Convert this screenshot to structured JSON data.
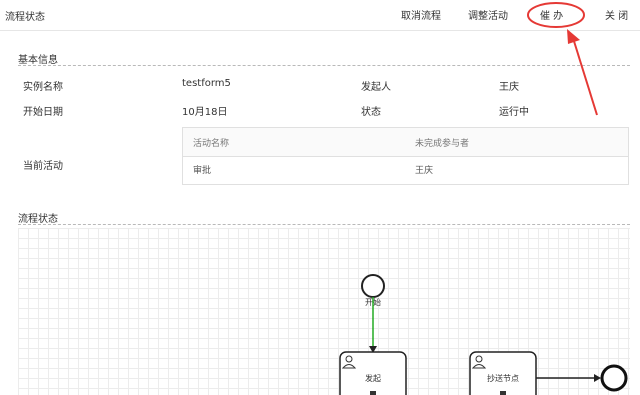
{
  "header": {
    "title": "流程状态",
    "buttons": {
      "cancel_process": "取消流程",
      "adjust_activity": "调整活动",
      "urge": "催 办",
      "close": "关 闭"
    }
  },
  "basic_info": {
    "section_title": "基本信息",
    "instance_name_label": "实例名称",
    "instance_name_value": "testform5",
    "initiator_label": "发起人",
    "initiator_value": "王庆",
    "start_date_label": "开始日期",
    "start_date_value": "10月18日",
    "status_label": "状态",
    "status_value": "运行中",
    "current_activity_label": "当前活动",
    "activity_table": {
      "columns": [
        "活动名称",
        "未完成参与者"
      ],
      "rows": [
        [
          "审批",
          "王庆"
        ]
      ]
    }
  },
  "process_status": {
    "section_title": "流程状态",
    "start_event_label": "开始",
    "task_initiate_label": "发起",
    "task_cc_label": "抄送节点",
    "colors": {
      "active_flow": "#22aa22",
      "annotation_red": "#e53935"
    }
  }
}
